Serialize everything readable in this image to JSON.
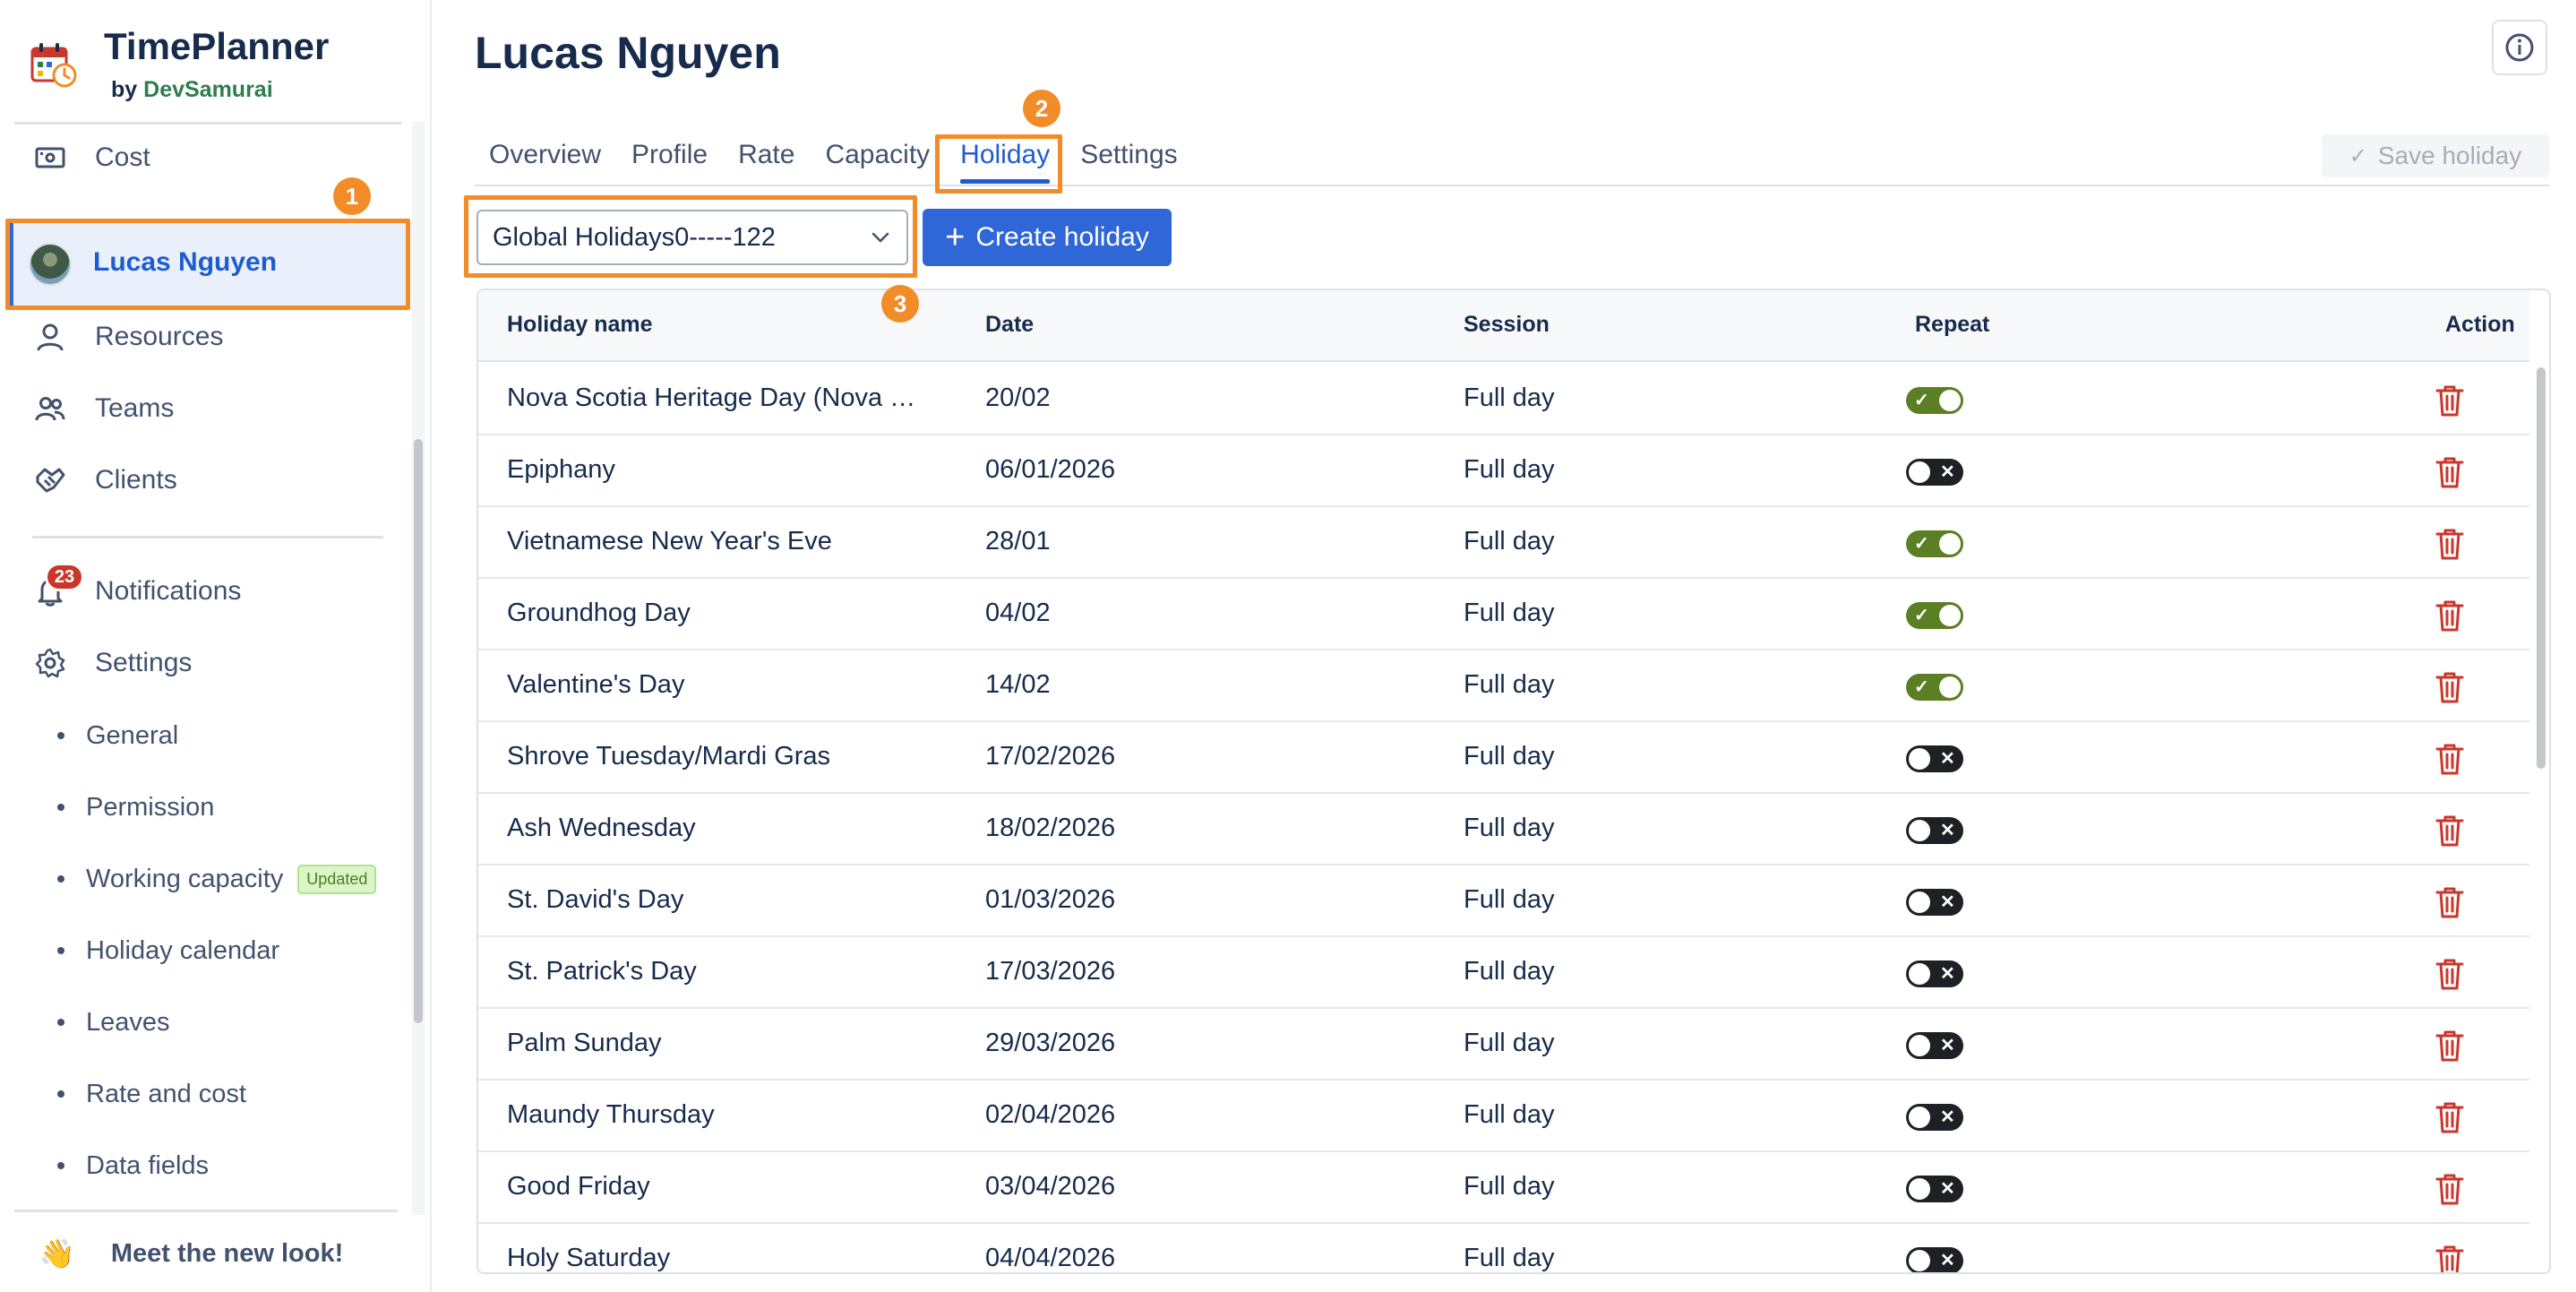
{
  "brand": {
    "title": "TimePlanner",
    "by": "by",
    "dev": "DevSamurai"
  },
  "sidebar": {
    "cost": "Cost",
    "active_user": "Lucas Nguyen",
    "resources": "Resources",
    "teams": "Teams",
    "clients": "Clients",
    "notifications": "Notifications",
    "notification_count": "23",
    "settings": "Settings",
    "sub_items": [
      "General",
      "Permission",
      "Working capacity",
      "Holiday calendar",
      "Leaves",
      "Rate and cost",
      "Data fields"
    ],
    "updated_badge": "Updated",
    "meet": "Meet the new look!"
  },
  "steps": [
    "1",
    "2",
    "3"
  ],
  "main": {
    "title": "Lucas Nguyen",
    "tabs": [
      "Overview",
      "Profile",
      "Rate",
      "Capacity",
      "Holiday",
      "Settings"
    ],
    "active_tab": "Holiday",
    "save_label": "Save holiday",
    "calendar_select": "Global Holidays0-----122",
    "create_label": "Create holiday"
  },
  "table": {
    "headers": [
      "Holiday name",
      "Date",
      "Session",
      "Repeat",
      "Action"
    ],
    "rows": [
      {
        "name": "Nova Scotia Heritage Day (Nova Scotia)",
        "date": "20/02",
        "session": "Full day",
        "repeat": true
      },
      {
        "name": "Epiphany",
        "date": "06/01/2026",
        "session": "Full day",
        "repeat": false
      },
      {
        "name": "Vietnamese New Year's Eve",
        "date": "28/01",
        "session": "Full day",
        "repeat": true
      },
      {
        "name": "Groundhog Day",
        "date": "04/02",
        "session": "Full day",
        "repeat": true
      },
      {
        "name": "Valentine's Day",
        "date": "14/02",
        "session": "Full day",
        "repeat": true
      },
      {
        "name": "Shrove Tuesday/Mardi Gras",
        "date": "17/02/2026",
        "session": "Full day",
        "repeat": false
      },
      {
        "name": "Ash Wednesday",
        "date": "18/02/2026",
        "session": "Full day",
        "repeat": false
      },
      {
        "name": "St. David's Day",
        "date": "01/03/2026",
        "session": "Full day",
        "repeat": false
      },
      {
        "name": "St. Patrick's Day",
        "date": "17/03/2026",
        "session": "Full day",
        "repeat": false
      },
      {
        "name": "Palm Sunday",
        "date": "29/03/2026",
        "session": "Full day",
        "repeat": false
      },
      {
        "name": "Maundy Thursday",
        "date": "02/04/2026",
        "session": "Full day",
        "repeat": false
      },
      {
        "name": "Good Friday",
        "date": "03/04/2026",
        "session": "Full day",
        "repeat": false
      },
      {
        "name": "Holy Saturday",
        "date": "04/04/2026",
        "session": "Full day",
        "repeat": false
      }
    ]
  },
  "colors": {
    "accent": "#2f66d8",
    "highlight": "#f28c28",
    "toggle_on": "#5b7f24",
    "toggle_off": "#1d2125",
    "danger": "#c9372c"
  }
}
